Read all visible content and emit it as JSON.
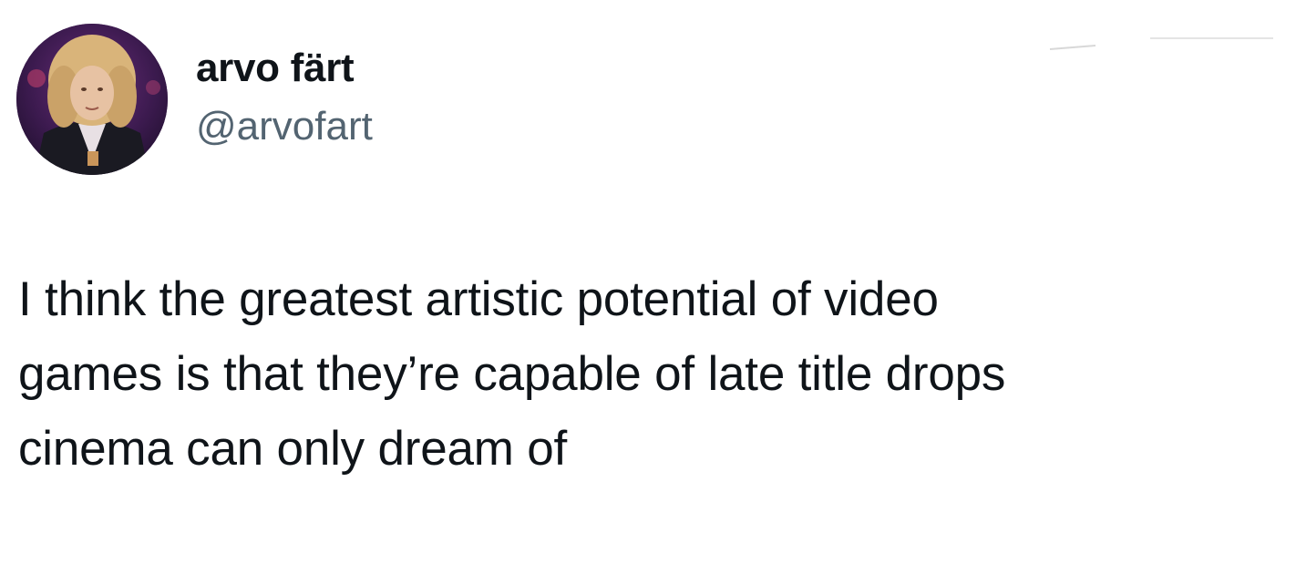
{
  "author": {
    "display_name": "arvo färt",
    "handle": "@arvofart"
  },
  "avatar": {
    "icon": "profile-photo"
  },
  "tweet": {
    "lines": [
      "I think the greatest artistic potential of video",
      "games is that they’re capable of late title drops",
      "cinema can only dream of"
    ]
  },
  "colors": {
    "text": "#0f1419",
    "secondary": "#536471",
    "background": "#ffffff"
  }
}
